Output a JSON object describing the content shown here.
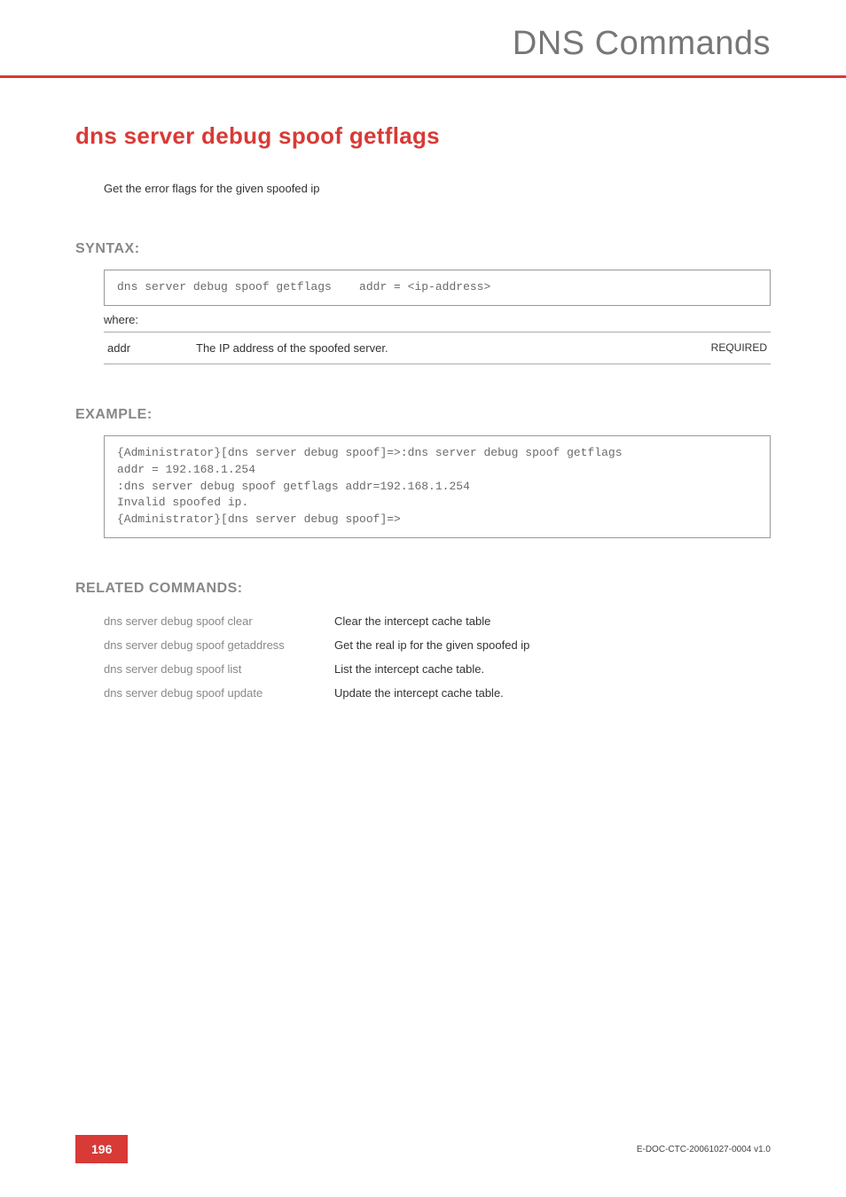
{
  "header": {
    "title": "DNS Commands"
  },
  "command": {
    "title": "dns server debug spoof getflags",
    "intro": "Get the error flags for the given spoofed ip"
  },
  "syntax": {
    "heading": "SYNTAX:",
    "code": "dns server debug spoof getflags    addr = <ip-address>",
    "where": "where:",
    "params": [
      {
        "name": "addr",
        "desc": "The IP address of the spoofed server.",
        "req": "REQUIRED"
      }
    ]
  },
  "example": {
    "heading": "EXAMPLE:",
    "code": "{Administrator}[dns server debug spoof]=>:dns server debug spoof getflags\naddr = 192.168.1.254\n:dns server debug spoof getflags addr=192.168.1.254\nInvalid spoofed ip.\n{Administrator}[dns server debug spoof]=>"
  },
  "related": {
    "heading": "RELATED COMMANDS:",
    "items": [
      {
        "cmd": "dns server debug spoof clear",
        "desc": "Clear the intercept cache table"
      },
      {
        "cmd": "dns server debug spoof getaddress",
        "desc": "Get the real ip for the given spoofed ip"
      },
      {
        "cmd": "dns server debug spoof list",
        "desc": "List the intercept cache table."
      },
      {
        "cmd": "dns server debug spoof update",
        "desc": "Update the intercept cache table."
      }
    ]
  },
  "footer": {
    "page": "196",
    "docid": "E-DOC-CTC-20061027-0004 v1.0"
  }
}
